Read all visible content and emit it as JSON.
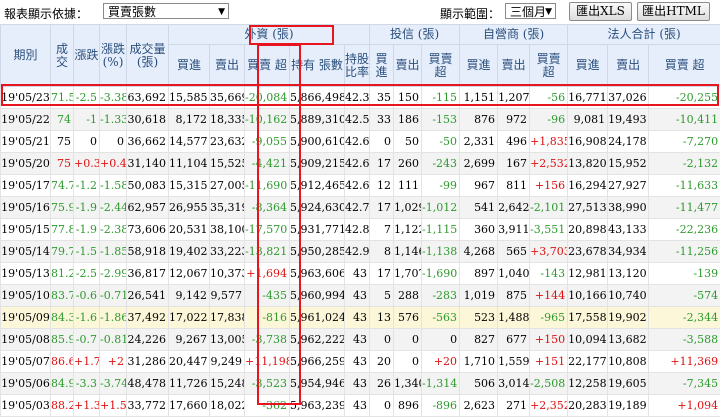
{
  "toolbar": {
    "display_basis_label": "報表顯示依據：",
    "display_basis_value": "買賣張數",
    "range_label": "顯示範圍：",
    "range_value": "三個月",
    "export_xls": "匯出XLS",
    "export_html": "匯出HTML"
  },
  "groups": {
    "foreign": "外資 (張)",
    "trust": "投信 (張)",
    "dealer": "自營商 (張)",
    "total": "法人合計 (張)"
  },
  "columns": {
    "date": "期別",
    "close": "成交",
    "change": "漲跌",
    "pct": "漲跌 (%)",
    "volume": "成交量 (張)",
    "buy": "買進",
    "sell": "賣出",
    "net": "買賣 超",
    "holding": "持有 張數",
    "ratio": "持股 比率"
  },
  "colors": {
    "up": "#e01010",
    "down": "#2e9a2e",
    "header_bg": "#e6eefb",
    "highlight": "#e8141e"
  },
  "rows": [
    {
      "date": "19'05/23",
      "close": "71.5",
      "chg": "-2.5",
      "pct": "-3.38",
      "vol": "63,692",
      "fb": "15,585",
      "fs": "35,669",
      "fn": "-20,084",
      "hold": "5,866,498",
      "ratio": "42.3",
      "tb": "35",
      "ts": "150",
      "tn": "-115",
      "db": "1,151",
      "ds": "1,207",
      "dn": "-56",
      "ab": "16,771",
      "as": "37,026",
      "an": "-20,255"
    },
    {
      "date": "19'05/22",
      "close": "74",
      "chg": "-1",
      "pct": "-1.33",
      "vol": "30,618",
      "fb": "8,172",
      "fs": "18,335",
      "fn": "-10,162",
      "hold": "5,889,310",
      "ratio": "42.5",
      "tb": "33",
      "ts": "186",
      "tn": "-153",
      "db": "876",
      "ds": "972",
      "dn": "-96",
      "ab": "9,081",
      "as": "19,493",
      "an": "-10,411"
    },
    {
      "date": "19'05/21",
      "close": "75",
      "chg": "0",
      "pct": "0",
      "vol": "36,662",
      "fb": "14,577",
      "fs": "23,632",
      "fn": "-9,055",
      "hold": "5,900,610",
      "ratio": "42.6",
      "tb": "0",
      "ts": "50",
      "tn": "-50",
      "db": "2,331",
      "ds": "496",
      "dn": "+1,835",
      "ab": "16,908",
      "as": "24,178",
      "an": "-7,270"
    },
    {
      "date": "19'05/20",
      "close": "75",
      "chg": "+0.3",
      "pct": "+0.4",
      "vol": "31,140",
      "fb": "11,104",
      "fs": "15,525",
      "fn": "-4,421",
      "hold": "5,909,215",
      "ratio": "42.6",
      "tb": "17",
      "ts": "260",
      "tn": "-243",
      "db": "2,699",
      "ds": "167",
      "dn": "+2,532",
      "ab": "13,820",
      "as": "15,952",
      "an": "-2,132"
    },
    {
      "date": "19'05/17",
      "close": "74.7",
      "chg": "-1.2",
      "pct": "-1.58",
      "vol": "50,083",
      "fb": "15,315",
      "fs": "27,005",
      "fn": "-11,690",
      "hold": "5,912,465",
      "ratio": "42.6",
      "tb": "12",
      "ts": "111",
      "tn": "-99",
      "db": "967",
      "ds": "811",
      "dn": "+156",
      "ab": "16,294",
      "as": "27,927",
      "an": "-11,633"
    },
    {
      "date": "19'05/16",
      "close": "75.9",
      "chg": "-1.9",
      "pct": "-2.44",
      "vol": "62,957",
      "fb": "26,955",
      "fs": "35,319",
      "fn": "-8,364",
      "hold": "5,924,630",
      "ratio": "42.7",
      "tb": "17",
      "ts": "1,029",
      "tn": "-1,012",
      "db": "541",
      "ds": "2,642",
      "dn": "-2,101",
      "ab": "27,513",
      "as": "38,990",
      "an": "-11,477"
    },
    {
      "date": "19'05/15",
      "close": "77.8",
      "chg": "-1.9",
      "pct": "-2.38",
      "vol": "73,606",
      "fb": "20,531",
      "fs": "38,100",
      "fn": "-17,570",
      "hold": "5,931,771",
      "ratio": "42.8",
      "tb": "7",
      "ts": "1,122",
      "tn": "-1,115",
      "db": "360",
      "ds": "3,911",
      "dn": "-3,551",
      "ab": "20,898",
      "as": "43,133",
      "an": "-22,236"
    },
    {
      "date": "19'05/14",
      "close": "79.7",
      "chg": "-1.5",
      "pct": "-1.85",
      "vol": "58,918",
      "fb": "19,402",
      "fs": "33,223",
      "fn": "-13,821",
      "hold": "5,950,285",
      "ratio": "42.9",
      "tb": "8",
      "ts": "1,146",
      "tn": "-1,138",
      "db": "4,268",
      "ds": "565",
      "dn": "+3,703",
      "ab": "23,678",
      "as": "34,934",
      "an": "-11,256"
    },
    {
      "date": "19'05/13",
      "close": "81.2",
      "chg": "-2.5",
      "pct": "-2.99",
      "vol": "36,817",
      "fb": "12,067",
      "fs": "10,373",
      "fn": "+1,694",
      "hold": "5,963,606",
      "ratio": "43",
      "tb": "17",
      "ts": "1,707",
      "tn": "-1,690",
      "db": "897",
      "ds": "1,040",
      "dn": "-143",
      "ab": "12,981",
      "as": "13,120",
      "an": "-139"
    },
    {
      "date": "19'05/10",
      "close": "83.7",
      "chg": "-0.6",
      "pct": "-0.71",
      "vol": "26,541",
      "fb": "9,142",
      "fs": "9,577",
      "fn": "-435",
      "hold": "5,960,994",
      "ratio": "43",
      "tb": "5",
      "ts": "288",
      "tn": "-283",
      "db": "1,019",
      "ds": "875",
      "dn": "+144",
      "ab": "10,166",
      "as": "10,740",
      "an": "-574"
    },
    {
      "date": "19'05/09",
      "close": "84.3",
      "chg": "-1.6",
      "pct": "-1.86",
      "vol": "37,492",
      "fb": "17,022",
      "fs": "17,838",
      "fn": "-816",
      "hold": "5,961,024",
      "ratio": "43",
      "tb": "13",
      "ts": "576",
      "tn": "-563",
      "db": "523",
      "ds": "1,488",
      "dn": "-965",
      "ab": "17,558",
      "as": "19,902",
      "an": "-2,344"
    },
    {
      "date": "19'05/08",
      "close": "85.9",
      "chg": "-0.7",
      "pct": "-0.81",
      "vol": "24,226",
      "fb": "9,267",
      "fs": "13,005",
      "fn": "-3,738",
      "hold": "5,962,222",
      "ratio": "43",
      "tb": "0",
      "ts": "0",
      "tn": "0",
      "db": "827",
      "ds": "677",
      "dn": "+150",
      "ab": "10,094",
      "as": "13,682",
      "an": "-3,588"
    },
    {
      "date": "19'05/07",
      "close": "86.6",
      "chg": "+1.7",
      "pct": "+2",
      "vol": "31,286",
      "fb": "20,447",
      "fs": "9,249",
      "fn": "+11,198",
      "hold": "5,966,259",
      "ratio": "43",
      "tb": "20",
      "ts": "0",
      "tn": "+20",
      "db": "1,710",
      "ds": "1,559",
      "dn": "+151",
      "ab": "22,177",
      "as": "10,808",
      "an": "+11,369"
    },
    {
      "date": "19'05/06",
      "close": "84.9",
      "chg": "-3.3",
      "pct": "-3.74",
      "vol": "48,478",
      "fb": "11,726",
      "fs": "15,248",
      "fn": "-3,523",
      "hold": "5,954,946",
      "ratio": "43",
      "tb": "26",
      "ts": "1,340",
      "tn": "-1,314",
      "db": "506",
      "ds": "3,014",
      "dn": "-2,508",
      "ab": "12,258",
      "as": "19,605",
      "an": "-7,345"
    },
    {
      "date": "19'05/03",
      "close": "88.2",
      "chg": "+1.3",
      "pct": "+1.5",
      "vol": "33,772",
      "fb": "17,660",
      "fs": "18,022",
      "fn": "-362",
      "hold": "5,963,239",
      "ratio": "43",
      "tb": "0",
      "ts": "896",
      "tn": "-896",
      "db": "2,623",
      "ds": "271",
      "dn": "+2,352",
      "ab": "20,283",
      "as": "19,189",
      "an": "+1,094"
    }
  ]
}
